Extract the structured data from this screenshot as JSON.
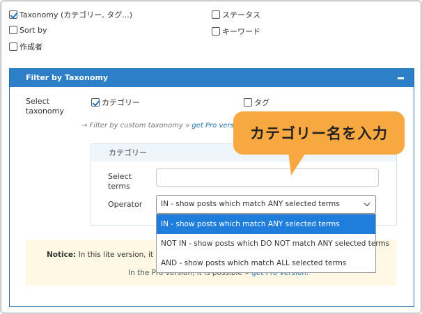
{
  "fields": {
    "taxonomy": {
      "label": "Taxonomy (カテゴリー, タグ...)",
      "checked": true
    },
    "status": {
      "label": "ステータス",
      "checked": false
    },
    "sort_by": {
      "label": "Sort by",
      "checked": false
    },
    "keyword": {
      "label": "キーワード",
      "checked": false
    },
    "author": {
      "label": "作成者",
      "checked": false
    }
  },
  "panel": {
    "title": "Filter by Taxonomy",
    "select_taxonomy_label": "Select taxonomy",
    "taxonomies": [
      {
        "label": "カテゴリー",
        "checked": true
      },
      {
        "label": "タグ",
        "checked": false
      }
    ],
    "hint_text": "→ Filter by custom taxonomy »",
    "hint_link": "get Pro vers"
  },
  "category_box": {
    "title": "カテゴリー",
    "select_terms_label": "Select terms",
    "terms_value": "",
    "operator_label": "Operator",
    "operator_selected": "IN - show posts which match ANY selected terms",
    "operator_options": [
      "IN - show posts which match ANY selected terms",
      "NOT IN - show posts which DO NOT match ANY selected terms",
      "AND - show posts which match ALL selected terms"
    ]
  },
  "notice": {
    "bold": "Notice:",
    "text": "In this lite version, it is n",
    "line2": "In the Pro version, it is possible »",
    "link": "get Pro version."
  },
  "callout": {
    "text": "カテゴリー名を入力"
  },
  "colors": {
    "accent": "#2d7fc7",
    "callout": "#f7a840",
    "selected_option": "#1f7ddb",
    "notice_bg": "#fff8e5"
  }
}
